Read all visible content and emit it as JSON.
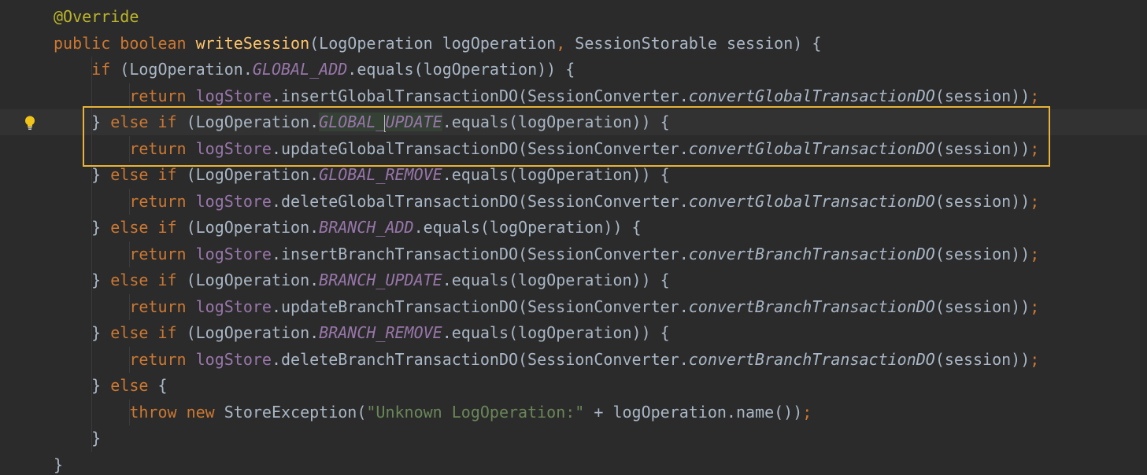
{
  "editor": {
    "theme_colors": {
      "background": "#2b2b2b",
      "keyword": "#cc7832",
      "annotation": "#bbb529",
      "function": "#ffc66d",
      "field": "#9876aa",
      "string": "#6a8759",
      "text": "#a9b7c6",
      "highlight_box": "#e8b339"
    },
    "gutter_icon": "lightbulb-icon",
    "lines": [
      [
        {
          "t": "@Override",
          "c": "ann"
        }
      ],
      [
        {
          "t": "public boolean ",
          "c": "kw"
        },
        {
          "t": "writeSession",
          "c": "fn"
        },
        {
          "t": "(LogOperation logOperation",
          "c": "ident"
        },
        {
          "t": ", ",
          "c": "kw"
        },
        {
          "t": "SessionStorable session) {",
          "c": "ident"
        }
      ],
      [
        {
          "t": "    "
        },
        {
          "t": "if ",
          "c": "kw"
        },
        {
          "t": "(LogOperation.",
          "c": "ident"
        },
        {
          "t": "GLOBAL_ADD",
          "c": "static"
        },
        {
          "t": ".equals(logOperation)) {",
          "c": "ident"
        }
      ],
      [
        {
          "t": "        "
        },
        {
          "t": "return ",
          "c": "kw"
        },
        {
          "t": "logStore",
          "c": "field"
        },
        {
          "t": ".insertGlobalTransactionDO(SessionConverter.",
          "c": "ident"
        },
        {
          "t": "convertGlobalTransactionDO",
          "c": "smeth"
        },
        {
          "t": "(session))",
          "c": "ident"
        },
        {
          "t": ";",
          "c": "kw"
        }
      ],
      [
        {
          "t": "    "
        },
        {
          "t": "} ",
          "c": "ident"
        },
        {
          "t": "else if ",
          "c": "kw"
        },
        {
          "t": "(LogOperation.",
          "c": "ident"
        },
        {
          "t": "GLOBAL_",
          "c": "static-sel"
        },
        {
          "t": "UPDATE",
          "c": "static-sel-caret"
        },
        {
          "t": ".equals(logOperation)) {",
          "c": "ident"
        }
      ],
      [
        {
          "t": "        "
        },
        {
          "t": "return ",
          "c": "kw"
        },
        {
          "t": "logStore",
          "c": "field"
        },
        {
          "t": ".updateGlobalTransactionDO(SessionConverter.",
          "c": "ident"
        },
        {
          "t": "convertGlobalTransactionDO",
          "c": "smeth"
        },
        {
          "t": "(session))",
          "c": "ident"
        },
        {
          "t": ";",
          "c": "kw"
        }
      ],
      [
        {
          "t": "    "
        },
        {
          "t": "} ",
          "c": "ident"
        },
        {
          "t": "else if ",
          "c": "kw"
        },
        {
          "t": "(LogOperation.",
          "c": "ident"
        },
        {
          "t": "GLOBAL_REMOVE",
          "c": "static"
        },
        {
          "t": ".equals(logOperation)) {",
          "c": "ident"
        }
      ],
      [
        {
          "t": "        "
        },
        {
          "t": "return ",
          "c": "kw"
        },
        {
          "t": "logStore",
          "c": "field"
        },
        {
          "t": ".deleteGlobalTransactionDO(SessionConverter.",
          "c": "ident"
        },
        {
          "t": "convertGlobalTransactionDO",
          "c": "smeth"
        },
        {
          "t": "(session))",
          "c": "ident"
        },
        {
          "t": ";",
          "c": "kw"
        }
      ],
      [
        {
          "t": "    "
        },
        {
          "t": "} ",
          "c": "ident"
        },
        {
          "t": "else if ",
          "c": "kw"
        },
        {
          "t": "(LogOperation.",
          "c": "ident"
        },
        {
          "t": "BRANCH_ADD",
          "c": "static"
        },
        {
          "t": ".equals(logOperation)) {",
          "c": "ident"
        }
      ],
      [
        {
          "t": "        "
        },
        {
          "t": "return ",
          "c": "kw"
        },
        {
          "t": "logStore",
          "c": "field"
        },
        {
          "t": ".insertBranchTransactionDO(SessionConverter.",
          "c": "ident"
        },
        {
          "t": "convertBranchTransactionDO",
          "c": "smeth"
        },
        {
          "t": "(session))",
          "c": "ident"
        },
        {
          "t": ";",
          "c": "kw"
        }
      ],
      [
        {
          "t": "    "
        },
        {
          "t": "} ",
          "c": "ident"
        },
        {
          "t": "else if ",
          "c": "kw"
        },
        {
          "t": "(LogOperation.",
          "c": "ident"
        },
        {
          "t": "BRANCH_UPDATE",
          "c": "static"
        },
        {
          "t": ".equals(logOperation)) {",
          "c": "ident"
        }
      ],
      [
        {
          "t": "        "
        },
        {
          "t": "return ",
          "c": "kw"
        },
        {
          "t": "logStore",
          "c": "field"
        },
        {
          "t": ".updateBranchTransactionDO(SessionConverter.",
          "c": "ident"
        },
        {
          "t": "convertBranchTransactionDO",
          "c": "smeth"
        },
        {
          "t": "(session))",
          "c": "ident"
        },
        {
          "t": ";",
          "c": "kw"
        }
      ],
      [
        {
          "t": "    "
        },
        {
          "t": "} ",
          "c": "ident"
        },
        {
          "t": "else if ",
          "c": "kw"
        },
        {
          "t": "(LogOperation.",
          "c": "ident"
        },
        {
          "t": "BRANCH_REMOVE",
          "c": "static"
        },
        {
          "t": ".equals(logOperation)) {",
          "c": "ident"
        }
      ],
      [
        {
          "t": "        "
        },
        {
          "t": "return ",
          "c": "kw"
        },
        {
          "t": "logStore",
          "c": "field"
        },
        {
          "t": ".deleteBranchTransactionDO(SessionConverter.",
          "c": "ident"
        },
        {
          "t": "convertBranchTransactionDO",
          "c": "smeth"
        },
        {
          "t": "(session))",
          "c": "ident"
        },
        {
          "t": ";",
          "c": "kw"
        }
      ],
      [
        {
          "t": "    "
        },
        {
          "t": "} ",
          "c": "ident"
        },
        {
          "t": "else ",
          "c": "kw"
        },
        {
          "t": "{",
          "c": "ident"
        }
      ],
      [
        {
          "t": "        "
        },
        {
          "t": "throw new ",
          "c": "kw"
        },
        {
          "t": "StoreException(",
          "c": "ident"
        },
        {
          "t": "\"Unknown LogOperation:\" ",
          "c": "str"
        },
        {
          "t": "+ logOperation.name())",
          "c": "ident"
        },
        {
          "t": ";",
          "c": "kw"
        }
      ],
      [
        {
          "t": "    "
        },
        {
          "t": "}",
          "c": "ident"
        }
      ],
      [
        {
          "t": "}",
          "c": "ident"
        }
      ]
    ],
    "current_line_index": 4
  }
}
